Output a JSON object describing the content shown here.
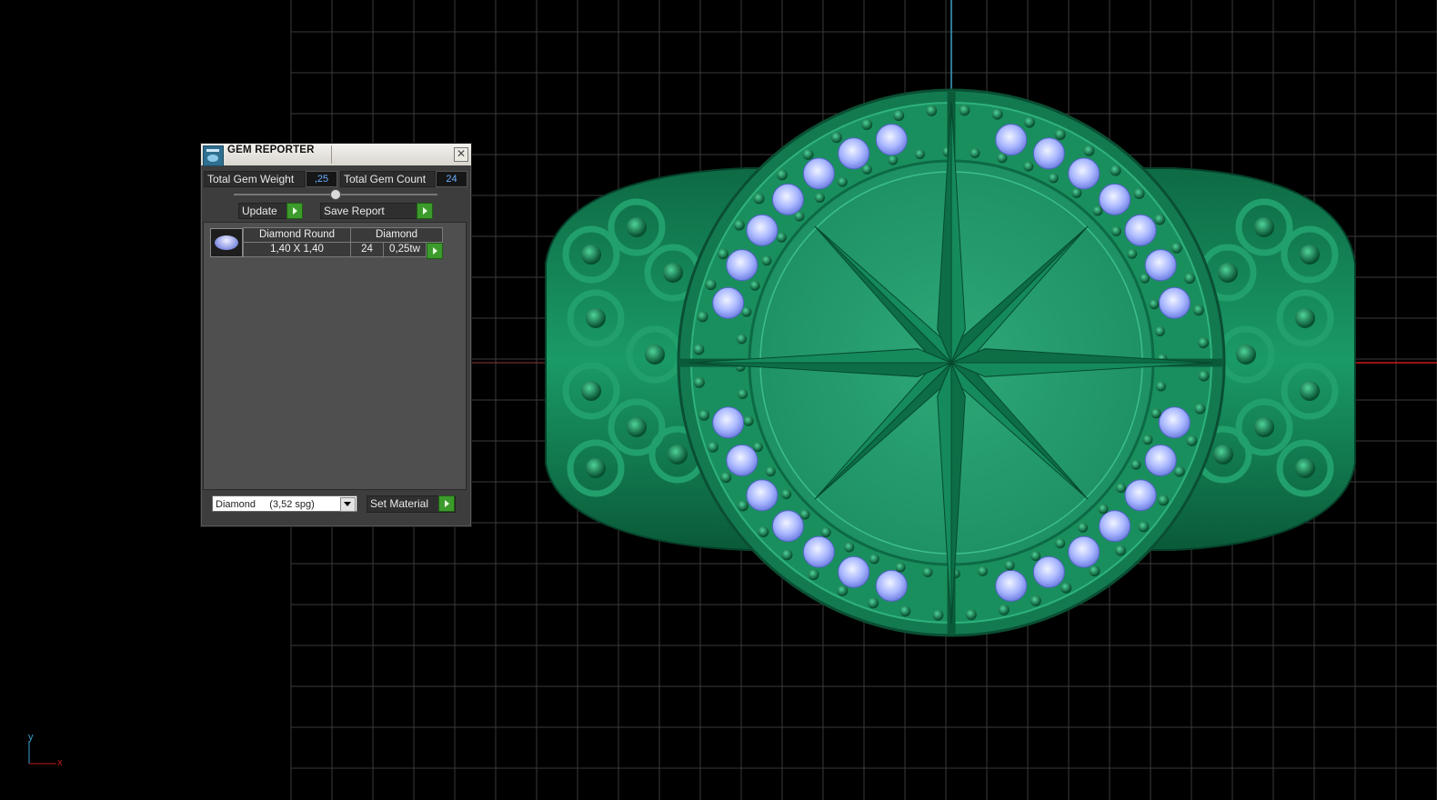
{
  "panel": {
    "title": "GEM REPORTER",
    "close_symbol": "✕",
    "total_weight_label": "Total Gem Weight",
    "total_weight_value": ",25",
    "total_count_label": "Total Gem Count",
    "total_count_value": "24",
    "update_label": "Update",
    "save_report_label": "Save Report",
    "gem_list": [
      {
        "shape": "Diamond Round",
        "size": "1,40 X 1,40",
        "material": "Diamond",
        "count": "24",
        "weight": "0,25tw"
      }
    ],
    "material_select_value": "Diamond     (3,52 spg)",
    "set_material_label": "Set Material"
  },
  "viewport": {
    "axis_y_label": "y",
    "axis_x_label": "x",
    "colors": {
      "background": "#000000",
      "grid": "#3a3a3a",
      "model_green": "#14865a",
      "gem_blue": "#a9b8ff",
      "axis_vertical": "#3aa0c8",
      "axis_horizontal": "#c81a1a"
    }
  }
}
